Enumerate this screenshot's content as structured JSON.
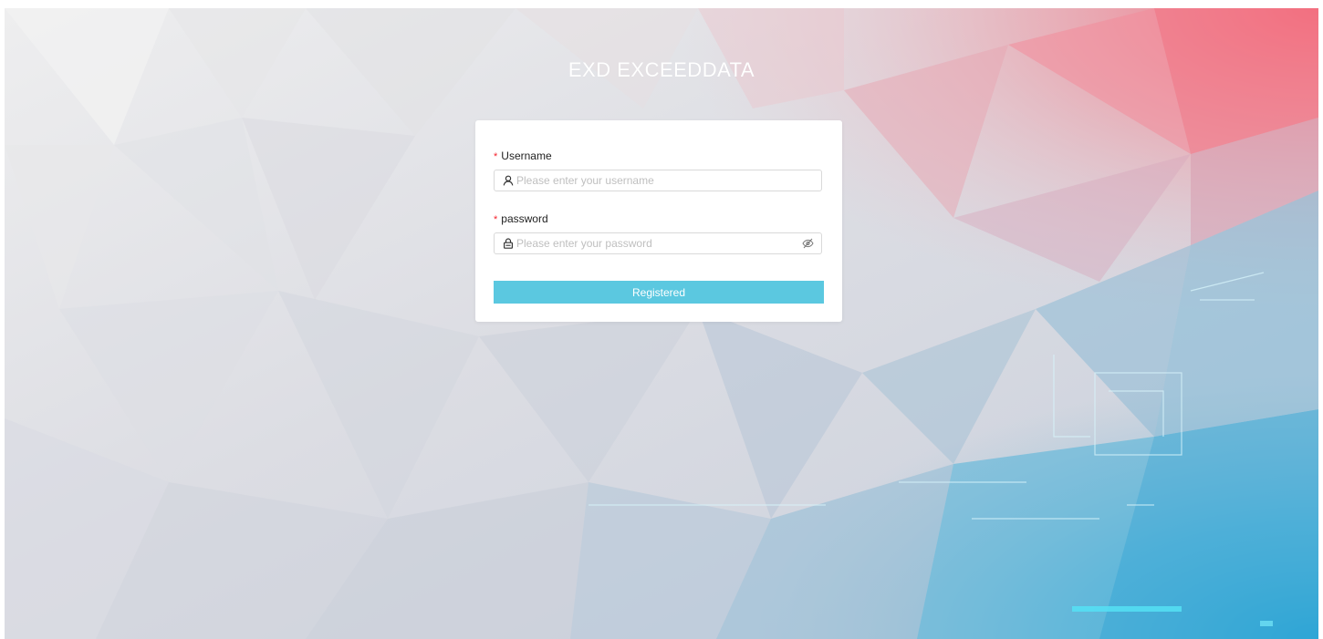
{
  "app": {
    "title": "EXD EXCEEDDATA"
  },
  "form": {
    "username": {
      "label": "Username",
      "required_mark": "*",
      "placeholder": "Please enter your username",
      "value": "",
      "icon": "user-icon"
    },
    "password": {
      "label": "password",
      "required_mark": "*",
      "placeholder": "Please enter your password",
      "value": "",
      "icon": "lock-icon",
      "toggle_icon": "eye-hidden-icon"
    },
    "submit_label": "Registered"
  },
  "colors": {
    "button": "#5bc8e0",
    "required": "#f5222d",
    "bg_top_right": "#f07585",
    "bg_bottom_right": "#3ab2d8"
  }
}
